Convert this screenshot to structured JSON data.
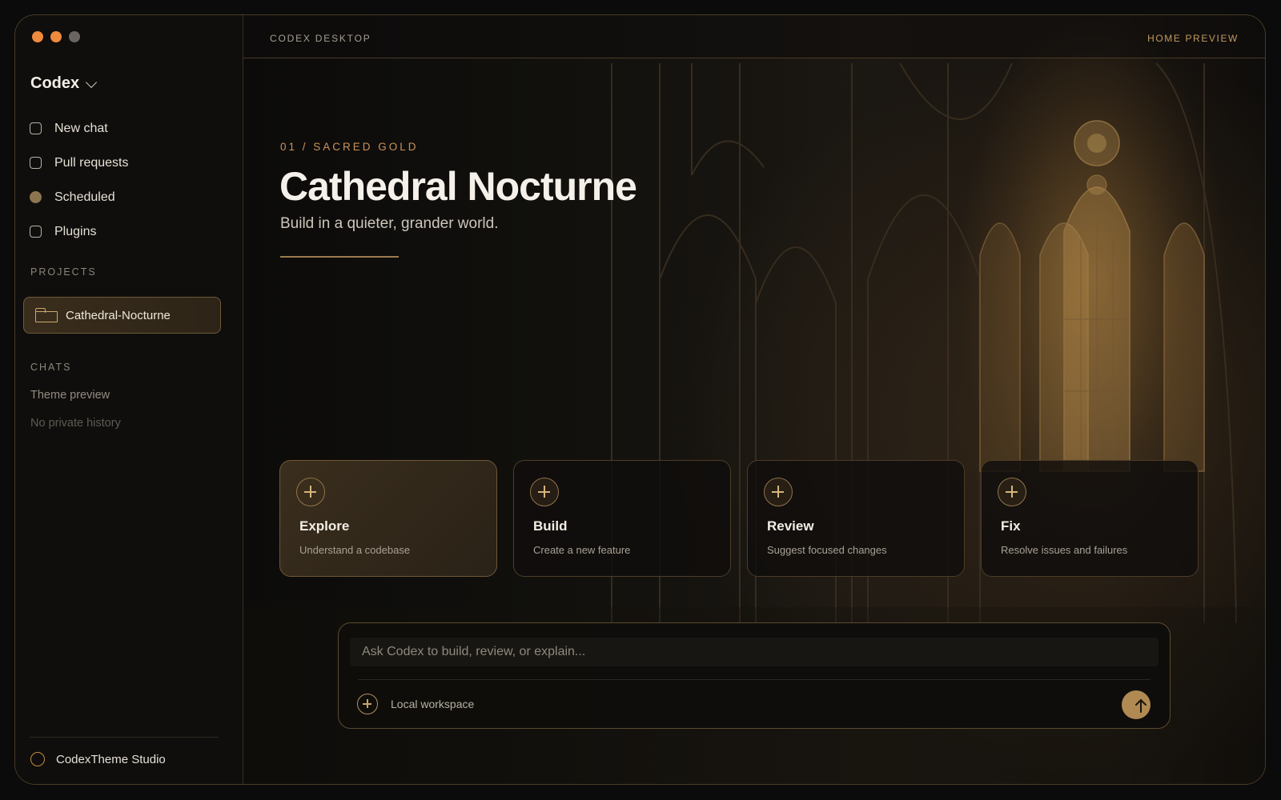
{
  "window": {
    "traffic_colors": [
      "#f08a3c",
      "#f08a3c",
      "#6a6560"
    ]
  },
  "sidebar": {
    "brand": "Codex",
    "nav": [
      {
        "label": "New chat",
        "icon": "square-icon"
      },
      {
        "label": "Pull requests",
        "icon": "square-icon"
      },
      {
        "label": "Scheduled",
        "icon": "filled-circle-icon"
      },
      {
        "label": "Plugins",
        "icon": "square-icon"
      }
    ],
    "projects_label": "PROJECTS",
    "projects": [
      {
        "label": "Cathedral-Nocturne",
        "icon": "folder-icon"
      }
    ],
    "chats_label": "CHATS",
    "chats": [
      {
        "label": "Theme preview"
      },
      {
        "label": "No private history"
      }
    ],
    "footer_user": "CodexTheme Studio"
  },
  "topbar": {
    "left": "CODEX DESKTOP",
    "right": "HOME PREVIEW"
  },
  "hero": {
    "eyebrow": "01 / SACRED GOLD",
    "title": "Cathedral Nocturne",
    "subtitle": "Build in a quieter, grander world."
  },
  "cards": [
    {
      "title": "Explore",
      "subtitle": "Understand a codebase"
    },
    {
      "title": "Build",
      "subtitle": "Create a new feature"
    },
    {
      "title": "Review",
      "subtitle": "Suggest focused changes"
    },
    {
      "title": "Fix",
      "subtitle": "Resolve issues and failures"
    }
  ],
  "composer": {
    "placeholder": "Ask Codex to build, review, or explain...",
    "workspace": "Local workspace"
  },
  "colors": {
    "accent": "#c9935a",
    "gold": "#b08a52",
    "border": "#4a3b25"
  }
}
